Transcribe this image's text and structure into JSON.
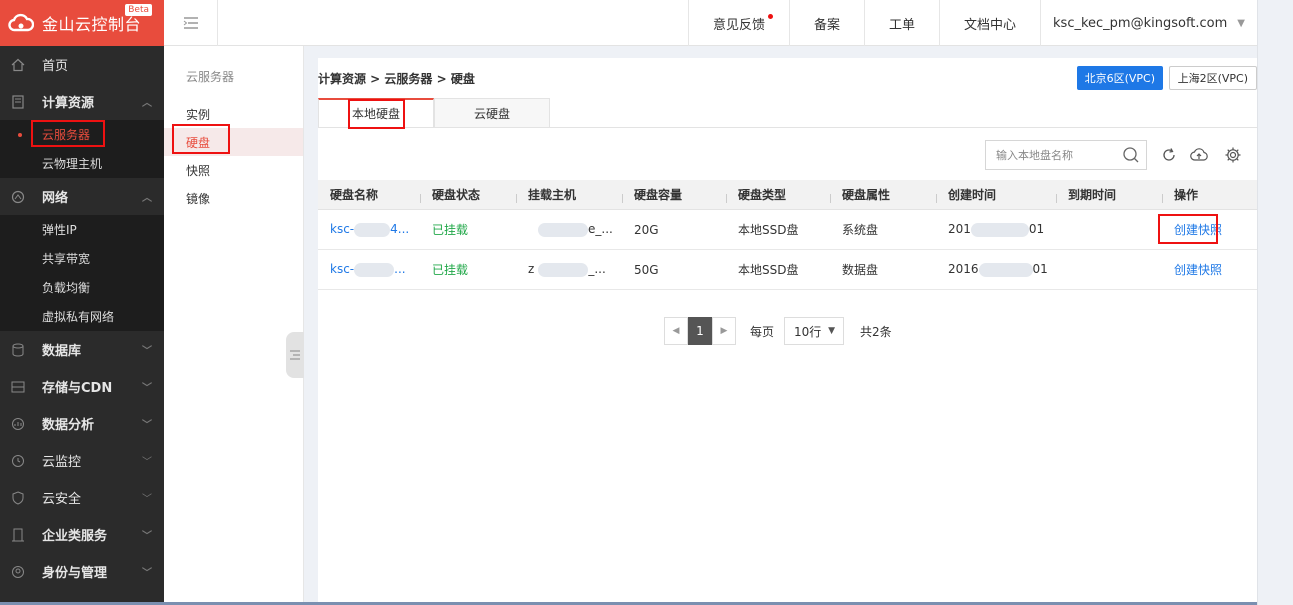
{
  "brand": {
    "title": "金山云控制台",
    "badge": "Beta"
  },
  "sidebar": {
    "items": [
      {
        "label": "首页",
        "icon": "home-icon"
      },
      {
        "label": "计算资源",
        "icon": "compute-icon",
        "expanded": true,
        "children": [
          {
            "label": "云服务器",
            "active": true
          },
          {
            "label": "云物理主机"
          }
        ]
      },
      {
        "label": "网络",
        "icon": "network-icon",
        "expanded": true,
        "children": [
          {
            "label": "弹性IP"
          },
          {
            "label": "共享带宽"
          },
          {
            "label": "负载均衡"
          },
          {
            "label": "虚拟私有网络"
          }
        ]
      },
      {
        "label": "数据库",
        "icon": "database-icon"
      },
      {
        "label": "存储与CDN",
        "icon": "storage-icon"
      },
      {
        "label": "数据分析",
        "icon": "analytics-icon"
      },
      {
        "label": "云监控",
        "icon": "monitor-icon"
      },
      {
        "label": "云安全",
        "icon": "security-icon"
      },
      {
        "label": "企业类服务",
        "icon": "enterprise-icon"
      },
      {
        "label": "身份与管理",
        "icon": "identity-icon"
      }
    ]
  },
  "topbar": {
    "feedback": "意见反馈",
    "beian": "备案",
    "ticket": "工单",
    "docs": "文档中心",
    "user": "ksc_kec_pm@kingsoft.com"
  },
  "subnav": {
    "title": "云服务器",
    "items": [
      {
        "label": "实例"
      },
      {
        "label": "硬盘",
        "active": true
      },
      {
        "label": "快照"
      },
      {
        "label": "镜像"
      }
    ]
  },
  "main": {
    "breadcrumb": "计算资源 > 云服务器 > 硬盘",
    "regions": {
      "active": "北京6区(VPC)",
      "other": "上海2区(VPC)"
    },
    "tabs": [
      {
        "label": "本地硬盘",
        "active": true
      },
      {
        "label": "云硬盘"
      }
    ],
    "search": {
      "placeholder": "输入本地盘名称"
    },
    "table": {
      "columns": [
        "硬盘名称",
        "硬盘状态",
        "挂载主机",
        "硬盘容量",
        "硬盘类型",
        "硬盘属性",
        "创建时间",
        "到期时间",
        "操作"
      ],
      "rows": [
        {
          "name": "ksc-",
          "name_tail": "4...",
          "status": "已挂载",
          "host_tail": "e_...",
          "capacity": "20G",
          "type": "本地SSD盘",
          "attr": "系统盘",
          "created": "201",
          "created_tail": "01",
          "expire": "",
          "action": "创建快照"
        },
        {
          "name": "ksc-",
          "name_tail": "...",
          "status": "已挂载",
          "host": "z",
          "host_tail": "_...",
          "capacity": "50G",
          "type": "本地SSD盘",
          "attr": "数据盘",
          "created": "2016",
          "created_tail": "01",
          "expire": "",
          "action": "创建快照"
        }
      ]
    },
    "pager": {
      "page": "1",
      "per_page_label": "每页",
      "per_page": "10行",
      "total": "共2条"
    }
  }
}
